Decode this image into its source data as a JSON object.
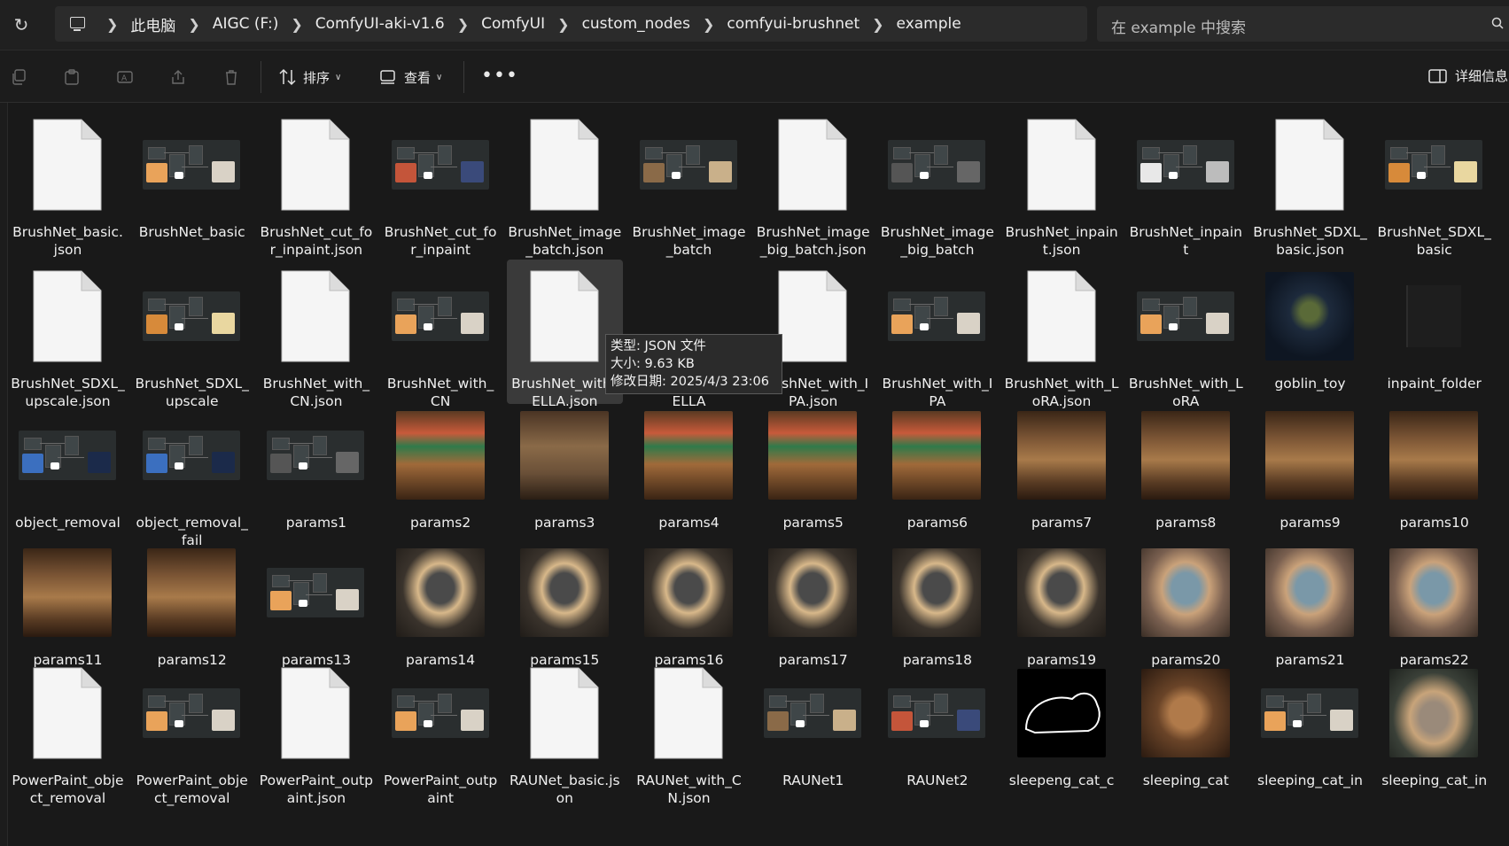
{
  "address_bar": {
    "breadcrumbs": [
      "此电脑",
      "AIGC (F:)",
      "ComfyUI-aki-v1.6",
      "ComfyUI",
      "custom_nodes",
      "comfyui-brushnet",
      "example"
    ],
    "search_placeholder": "在 example 中搜索"
  },
  "toolbar": {
    "sort_label": "排序",
    "view_label": "查看",
    "more_label": "•••",
    "details_label": "详细信息"
  },
  "tooltip": {
    "type": "类型: JSON 文件",
    "size": "大小: 9.63 KB",
    "modified": "修改日期: 2025/4/3 23:06"
  },
  "files": [
    {
      "name": "BrushNet_basic.json",
      "kind": "doc"
    },
    {
      "name": "BrushNet_basic",
      "kind": "workflow",
      "accent": "teacup"
    },
    {
      "name": "BrushNet_cut_for_inpaint.json",
      "kind": "doc"
    },
    {
      "name": "BrushNet_cut_for_inpaint",
      "kind": "workflow",
      "accent": "dark"
    },
    {
      "name": "BrushNet_image_batch.json",
      "kind": "doc"
    },
    {
      "name": "BrushNet_image_batch",
      "kind": "workflow",
      "accent": "cards"
    },
    {
      "name": "BrushNet_image_big_batch.json",
      "kind": "doc"
    },
    {
      "name": "BrushNet_image_big_batch",
      "kind": "workflow",
      "accent": "plain"
    },
    {
      "name": "BrushNet_inpaint.json",
      "kind": "doc"
    },
    {
      "name": "BrushNet_inpaint",
      "kind": "workflow",
      "accent": "white"
    },
    {
      "name": "BrushNet_SDXL_basic.json",
      "kind": "doc"
    },
    {
      "name": "BrushNet_SDXL_basic",
      "kind": "workflow",
      "accent": "food"
    },
    {
      "name": "BrushNet_SDXL_upscale.json",
      "kind": "doc"
    },
    {
      "name": "BrushNet_SDXL_upscale",
      "kind": "workflow",
      "accent": "food"
    },
    {
      "name": "BrushNet_with_CN.json",
      "kind": "doc"
    },
    {
      "name": "BrushNet_with_CN",
      "kind": "workflow",
      "accent": "teacup"
    },
    {
      "name": "BrushNet_with_ELLA.json",
      "kind": "doc",
      "hover": true
    },
    {
      "name": "BrushNet_with_ELLA",
      "kind": "blank"
    },
    {
      "name": "BrushNet_with_IPA.json",
      "kind": "doc"
    },
    {
      "name": "BrushNet_with_IPA",
      "kind": "workflow",
      "accent": "teacup"
    },
    {
      "name": "BrushNet_with_LoRA.json",
      "kind": "doc"
    },
    {
      "name": "BrushNet_with_LoRA",
      "kind": "workflow",
      "accent": "teacup"
    },
    {
      "name": "goblin_toy",
      "kind": "photo",
      "scene": "goblin-dark"
    },
    {
      "name": "inpaint_folder",
      "kind": "textfile"
    },
    {
      "name": "object_removal",
      "kind": "workflow",
      "accent": "blue"
    },
    {
      "name": "object_removal_fail",
      "kind": "workflow",
      "accent": "blue"
    },
    {
      "name": "params1",
      "kind": "workflow",
      "accent": "plain"
    },
    {
      "name": "params2",
      "kind": "photo",
      "scene": "shop-bright"
    },
    {
      "name": "params3",
      "kind": "photo",
      "scene": "shop-empty"
    },
    {
      "name": "params4",
      "kind": "photo",
      "scene": "shop-bright"
    },
    {
      "name": "params5",
      "kind": "photo",
      "scene": "shop-bright"
    },
    {
      "name": "params6",
      "kind": "photo",
      "scene": "shop-bright"
    },
    {
      "name": "params7",
      "kind": "photo",
      "scene": "shop-warm"
    },
    {
      "name": "params8",
      "kind": "photo",
      "scene": "shop-warm"
    },
    {
      "name": "params9",
      "kind": "photo",
      "scene": "shop-warm"
    },
    {
      "name": "params10",
      "kind": "photo",
      "scene": "shop-warm"
    },
    {
      "name": "params11",
      "kind": "photo",
      "scene": "shop-warm"
    },
    {
      "name": "params12",
      "kind": "photo",
      "scene": "shop-warm"
    },
    {
      "name": "params13",
      "kind": "workflow",
      "accent": "teacup"
    },
    {
      "name": "params14",
      "kind": "photo",
      "scene": "teapot-dark"
    },
    {
      "name": "params15",
      "kind": "photo",
      "scene": "teapot-dark"
    },
    {
      "name": "params16",
      "kind": "photo",
      "scene": "teapot-dark"
    },
    {
      "name": "params17",
      "kind": "photo",
      "scene": "teapot-dark"
    },
    {
      "name": "params18",
      "kind": "photo",
      "scene": "teapot-dark"
    },
    {
      "name": "params19",
      "kind": "photo",
      "scene": "teapot-dark"
    },
    {
      "name": "params20",
      "kind": "photo",
      "scene": "teapot-blue"
    },
    {
      "name": "params21",
      "kind": "photo",
      "scene": "teapot-blue"
    },
    {
      "name": "params22",
      "kind": "photo",
      "scene": "teapot-blue"
    },
    {
      "name": "PowerPaint_object_removal",
      "kind": "doc"
    },
    {
      "name": "PowerPaint_object_removal",
      "kind": "workflow",
      "accent": "teacup"
    },
    {
      "name": "PowerPaint_outpaint.json",
      "kind": "doc"
    },
    {
      "name": "PowerPaint_outpaint",
      "kind": "workflow",
      "accent": "teacup"
    },
    {
      "name": "RAUNet_basic.json",
      "kind": "doc"
    },
    {
      "name": "RAUNet_with_CN.json",
      "kind": "doc"
    },
    {
      "name": "RAUNet1",
      "kind": "workflow",
      "accent": "cards"
    },
    {
      "name": "RAUNet2",
      "kind": "workflow",
      "accent": "dark"
    },
    {
      "name": "sleepeng_cat_c",
      "kind": "photo",
      "scene": "cat-mask"
    },
    {
      "name": "sleeping_cat",
      "kind": "photo",
      "scene": "cat"
    },
    {
      "name": "sleeping_cat_in",
      "kind": "workflow",
      "accent": "teacup"
    },
    {
      "name": "sleeping_cat_in",
      "kind": "photo",
      "scene": "cat-plate"
    }
  ],
  "colors": {
    "window_bg": "#191919",
    "bar_bg": "#202020",
    "field_bg": "#2b2b2b",
    "hover_bg": "#3a3a3a",
    "doc_white": "#f5f5f5"
  }
}
